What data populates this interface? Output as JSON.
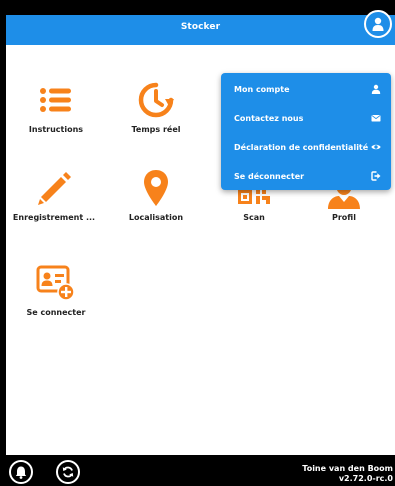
{
  "header": {
    "title": "Stocker",
    "avatar_icon": "user-circle-icon"
  },
  "tiles": [
    {
      "label": "Instructions",
      "icon": "list-icon"
    },
    {
      "label": "Temps réel",
      "icon": "clock-history-icon"
    },
    {
      "label": "Enregistrement ...",
      "icon": "pencil-icon"
    },
    {
      "label": "Localisation",
      "icon": "map-marker-icon"
    },
    {
      "label": "Scan",
      "icon": "qrcode-icon"
    },
    {
      "label": "Profil",
      "icon": "worker-icon"
    },
    {
      "label": "Se connecter",
      "icon": "id-card-add-icon"
    }
  ],
  "menu": {
    "items": [
      {
        "label": "Mon compte",
        "icon": "user-icon"
      },
      {
        "label": "Contactez nous",
        "icon": "envelope-icon"
      },
      {
        "label": "Déclaration de confidentialité",
        "icon": "eye-icon"
      },
      {
        "label": "Se déconnecter",
        "icon": "sign-out-icon"
      }
    ]
  },
  "footer": {
    "user_name": "Toine van den Boom",
    "version": "v2.72.0-rc.0",
    "bell_icon": "bell-icon",
    "sync_icon": "sync-icon"
  },
  "colors": {
    "accent": "#1e8ee8",
    "icon_orange": "#f7821b",
    "background": "#ffffff",
    "bar": "#000000"
  }
}
